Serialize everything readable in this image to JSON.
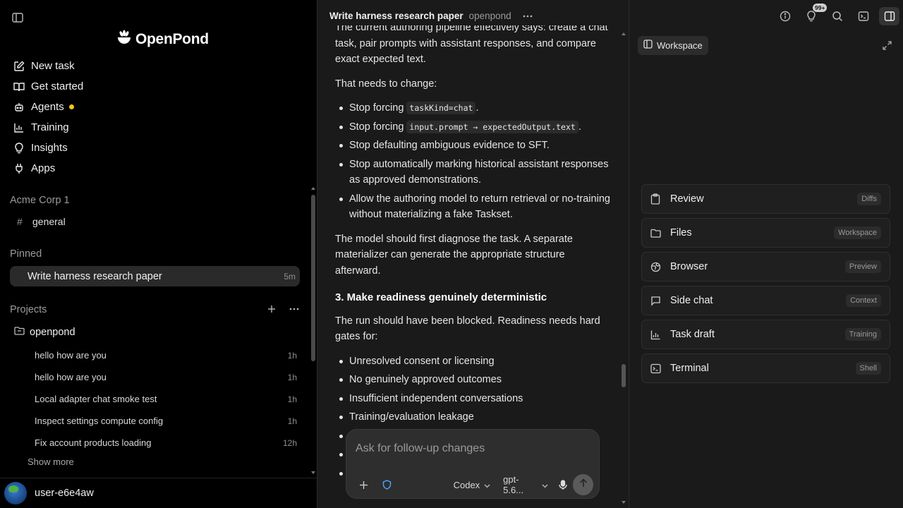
{
  "brand": {
    "name": "OpenPond"
  },
  "nav": [
    {
      "label": "New task",
      "icon": "edit-icon"
    },
    {
      "label": "Get started",
      "icon": "book-icon"
    },
    {
      "label": "Agents",
      "icon": "agents-icon"
    },
    {
      "label": "Training",
      "icon": "chart-icon"
    },
    {
      "label": "Insights",
      "icon": "lightbulb-icon"
    },
    {
      "label": "Apps",
      "icon": "plug-icon"
    }
  ],
  "workspace_org": {
    "label": "Acme Corp 1",
    "channel": "general",
    "channel_prefix": "#"
  },
  "pinned": {
    "label": "Pinned",
    "item": {
      "title": "Write harness research paper",
      "time": "5m"
    }
  },
  "projects": {
    "label": "Projects",
    "project": "openpond",
    "items": [
      {
        "title": "hello how are you",
        "time": "1h"
      },
      {
        "title": "hello how are you",
        "time": "1h"
      },
      {
        "title": "Local adapter chat smoke test",
        "time": "1h"
      },
      {
        "title": "Inspect settings compute config",
        "time": "1h"
      },
      {
        "title": "Fix account products loading",
        "time": "12h"
      }
    ],
    "show_more": "Show more"
  },
  "user": {
    "name": "user-e6e4aw"
  },
  "thread": {
    "title": "Write harness research paper",
    "project": "openpond"
  },
  "chat": {
    "para_1": "The current authoring pipeline effectively says: create a chat task, pair prompts with assistant responses, and compare exact expected text.",
    "para_2": "That needs to change:",
    "list_1": {
      "item_1_prefix": "Stop forcing ",
      "item_1_code": "taskKind=chat",
      "item_1_suffix": ".",
      "item_2_prefix": "Stop forcing ",
      "item_2_code": "input.prompt → expectedOutput.text",
      "item_2_suffix": ".",
      "item_3": "Stop defaulting ambiguous evidence to SFT.",
      "item_4": "Stop automatically marking historical assistant responses as approved demonstrations.",
      "item_5": "Allow the authoring model to return retrieval or no-training without materializing a fake Taskset."
    },
    "para_3": "The model should first diagnose the task. A separate materializer can generate the appropriate structure afterward.",
    "heading": "3. Make readiness genuinely deterministic",
    "para_4": "The run should have been blocked. Readiness needs hard gates for:",
    "list_2": [
      "Unresolved consent or licensing",
      "No genuinely approved outcomes",
      "Insufficient independent conversations",
      "Training/evaluation leakage"
    ]
  },
  "composer": {
    "placeholder": "Ask for follow-up changes",
    "agent": "Codex",
    "model": "gpt-5.6..."
  },
  "top_bar": {
    "badge": "99+"
  },
  "right_panel": {
    "tab": "Workspace",
    "cards": [
      {
        "label": "Review",
        "tag": "Diffs",
        "icon": "clipboard-icon"
      },
      {
        "label": "Files",
        "tag": "Workspace",
        "icon": "folder-icon"
      },
      {
        "label": "Browser",
        "tag": "Preview",
        "icon": "globe-icon"
      },
      {
        "label": "Side chat",
        "tag": "Context",
        "icon": "chat-bubble-icon"
      },
      {
        "label": "Task draft",
        "tag": "Training",
        "icon": "chart-icon"
      },
      {
        "label": "Terminal",
        "tag": "Shell",
        "icon": "terminal-icon"
      }
    ]
  },
  "colors": {
    "agent_dot": "#f5c518",
    "sidebar_bg": "#000000",
    "panel_bg": "#1a1a1a",
    "selected_bg": "#2a2a2a"
  }
}
